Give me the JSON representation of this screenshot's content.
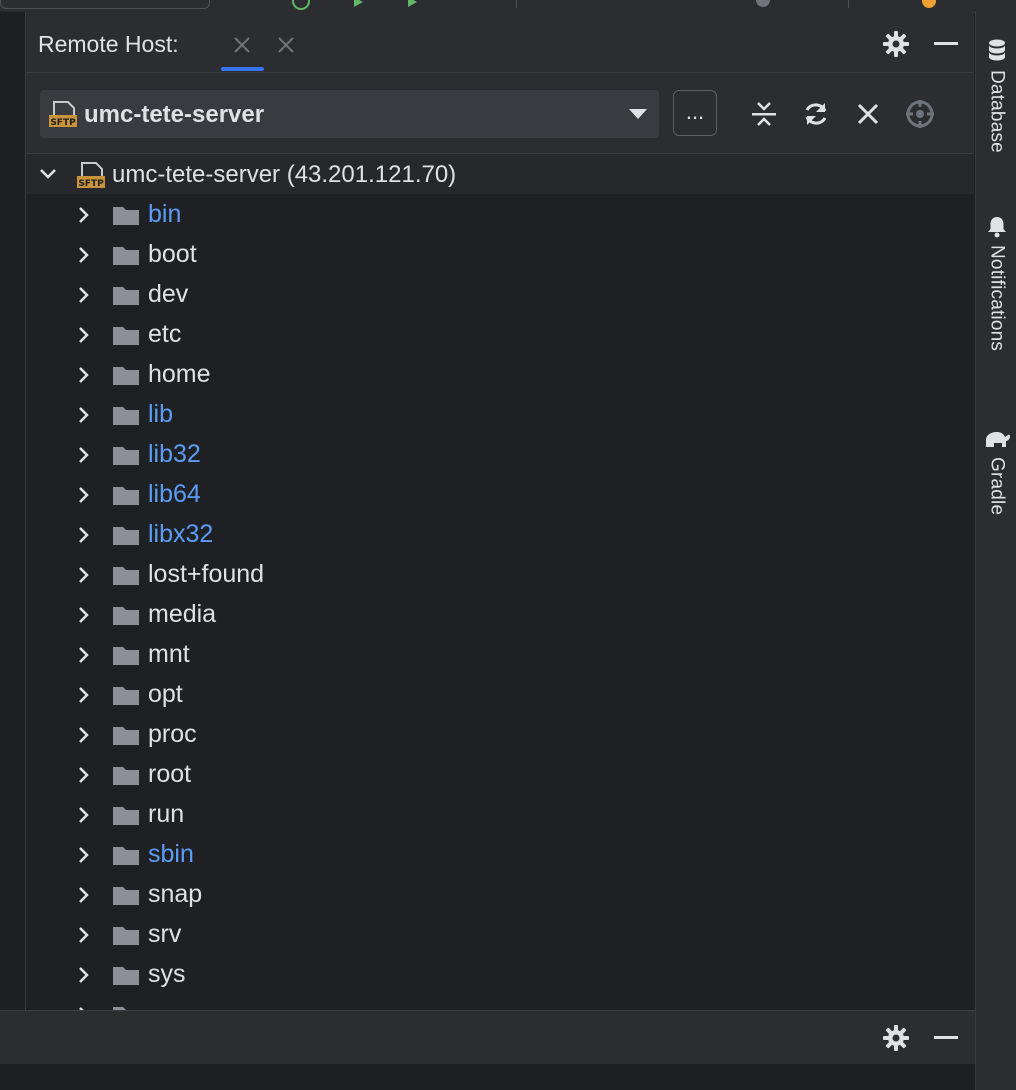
{
  "panel": {
    "title": "Remote Host:"
  },
  "toolbar": {
    "host_selected": "umc-tete-server",
    "more_label": "..."
  },
  "tree": {
    "root_label": "umc-tete-server (43.201.121.70)",
    "items": [
      {
        "name": "bin",
        "kind": "link"
      },
      {
        "name": "boot",
        "kind": "dir"
      },
      {
        "name": "dev",
        "kind": "dir"
      },
      {
        "name": "etc",
        "kind": "dir"
      },
      {
        "name": "home",
        "kind": "dir"
      },
      {
        "name": "lib",
        "kind": "link"
      },
      {
        "name": "lib32",
        "kind": "link"
      },
      {
        "name": "lib64",
        "kind": "link"
      },
      {
        "name": "libx32",
        "kind": "link"
      },
      {
        "name": "lost+found",
        "kind": "dir"
      },
      {
        "name": "media",
        "kind": "dir"
      },
      {
        "name": "mnt",
        "kind": "dir"
      },
      {
        "name": "opt",
        "kind": "dir"
      },
      {
        "name": "proc",
        "kind": "dir"
      },
      {
        "name": "root",
        "kind": "dir"
      },
      {
        "name": "run",
        "kind": "dir"
      },
      {
        "name": "sbin",
        "kind": "link"
      },
      {
        "name": "snap",
        "kind": "dir"
      },
      {
        "name": "srv",
        "kind": "dir"
      },
      {
        "name": "sys",
        "kind": "dir"
      }
    ]
  },
  "side_tabs": {
    "database": "Database",
    "notifications": "Notifications",
    "gradle": "Gradle"
  },
  "icons": {
    "sftp": "sftp-server-icon",
    "folder": "folder-icon",
    "settings": "gear-icon",
    "minimize": "minimize-icon",
    "collapse_all": "collapse-all-icon",
    "refresh": "refresh-icon",
    "close": "close-icon",
    "locate": "locate-icon"
  },
  "colors": {
    "panel_bg": "#2b2d30",
    "tree_bg": "#1f2024",
    "text": "#dfe1e5",
    "link_text": "#5b9df5",
    "accent": "#3574f0",
    "sftp_badge": "#c9933a",
    "folder": "#8c8f95"
  }
}
